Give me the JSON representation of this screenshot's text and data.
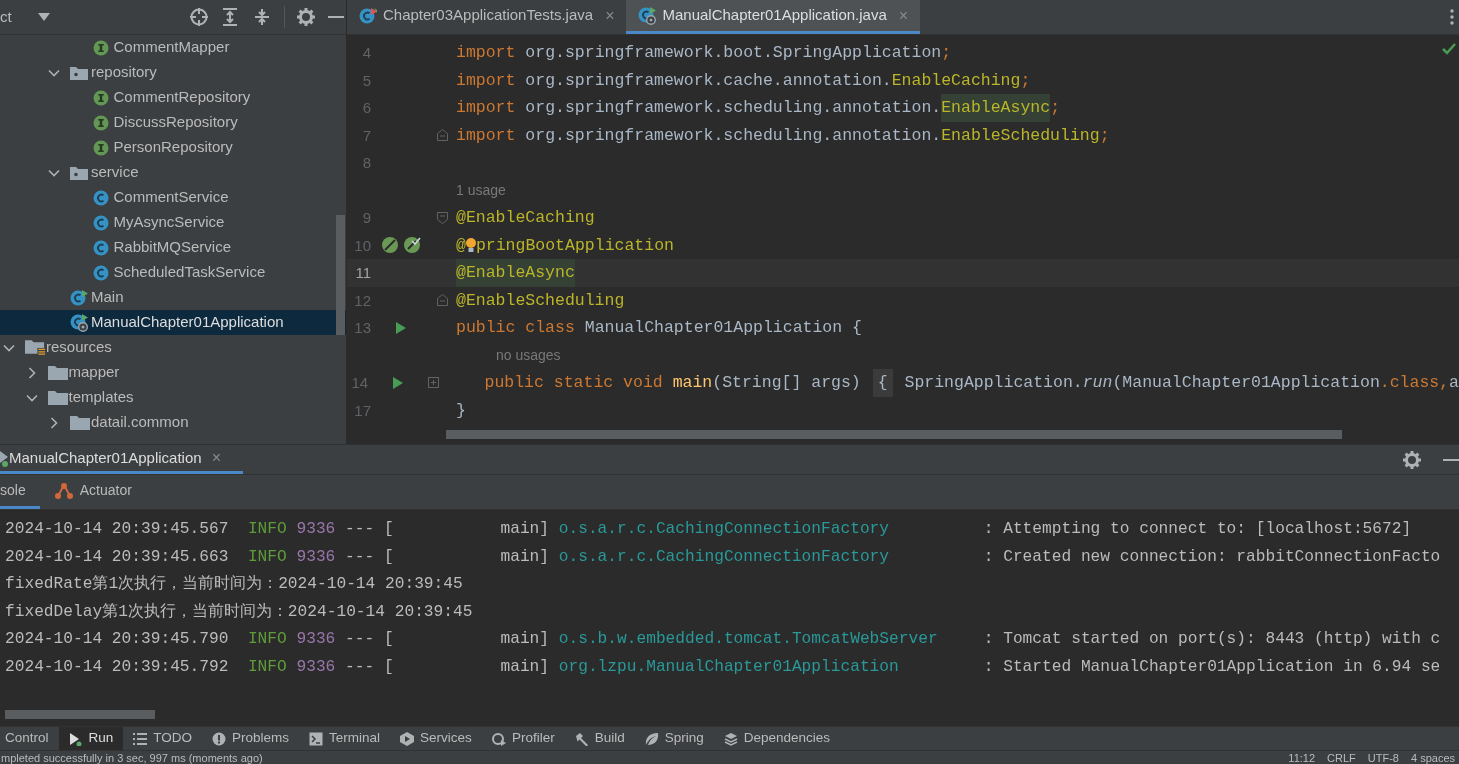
{
  "project_panel": {
    "title": "ct",
    "tree": [
      {
        "children": [
          {
            "children": [
              {
                "children": [
                  {
                    "label": "CommentMapper",
                    "kind": "interface",
                    "selected": false
                  }
                ]
              },
              {
                "label": "repository",
                "kind": "package",
                "expanded": true,
                "selected": false,
                "children": [
                  {
                    "label": "CommentRepository",
                    "kind": "interface",
                    "selected": false
                  },
                  {
                    "label": "DiscussRepository",
                    "kind": "interface",
                    "selected": false
                  },
                  {
                    "label": "PersonRepository",
                    "kind": "interface",
                    "selected": false
                  }
                ]
              },
              {
                "label": "service",
                "kind": "package",
                "expanded": true,
                "selected": false,
                "children": [
                  {
                    "label": "CommentService",
                    "kind": "class",
                    "selected": false
                  },
                  {
                    "label": "MyAsyncService",
                    "kind": "class",
                    "selected": false
                  },
                  {
                    "label": "RabbitMQService",
                    "kind": "class",
                    "selected": false
                  },
                  {
                    "label": "ScheduledTaskService",
                    "kind": "class",
                    "selected": false
                  }
                ]
              },
              {
                "label": "Main",
                "kind": "main-class",
                "selected": false
              },
              {
                "label": "ManualChapter01Application",
                "kind": "spring-app",
                "selected": true
              }
            ]
          }
        ]
      },
      {
        "label": "resources",
        "kind": "resources",
        "expanded": true,
        "selected": false,
        "children": [
          {
            "label": "mapper",
            "kind": "folder",
            "expanded": false,
            "selected": false
          },
          {
            "label": "templates",
            "kind": "folder",
            "expanded": true,
            "selected": false,
            "children": [
              {
                "label": "datail.common",
                "kind": "folder",
                "expanded": false,
                "selected": false
              }
            ]
          }
        ]
      }
    ]
  },
  "editor_tabs": [
    {
      "label": "Chapter03ApplicationTests.java",
      "close": "×",
      "kind": "test-class",
      "selected": false
    },
    {
      "label": "ManualChapter01Application.java",
      "close": "×",
      "kind": "spring-app",
      "selected": true
    }
  ],
  "code_lines": [
    {
      "number": "4",
      "current": false,
      "tokens": [
        {
          "kind": "kw",
          "text": "import"
        },
        {
          "kind": "plain",
          "text": " org.springframework.boot.SpringApplication"
        },
        {
          "kind": "kw",
          "text": ";"
        }
      ]
    },
    {
      "number": "5",
      "current": false,
      "tokens": [
        {
          "kind": "kw",
          "text": "import"
        },
        {
          "kind": "plain",
          "text": " org.springframework.cache.annotation."
        },
        {
          "kind": "ann",
          "text": "EnableCaching"
        },
        {
          "kind": "kw",
          "text": ";"
        }
      ]
    },
    {
      "number": "6",
      "current": false,
      "tokens": [
        {
          "kind": "kw",
          "text": "import"
        },
        {
          "kind": "plain",
          "text": " org.springframework.scheduling.annotation."
        },
        {
          "kind": "ann-hl",
          "text": "EnableAsync"
        },
        {
          "kind": "kw",
          "text": ";"
        }
      ]
    },
    {
      "number": "7",
      "current": false,
      "fold_end": true,
      "tokens": [
        {
          "kind": "kw",
          "text": "import"
        },
        {
          "kind": "plain",
          "text": " org.springframework.scheduling.annotation."
        },
        {
          "kind": "ann",
          "text": "EnableScheduling"
        },
        {
          "kind": "kw",
          "text": ";"
        }
      ]
    },
    {
      "number": "8",
      "current": false
    },
    {
      "hint": "1 usage"
    },
    {
      "number": "9",
      "current": false,
      "fold_start": true,
      "tokens": [
        {
          "kind": "ann",
          "text": "@EnableCaching"
        }
      ]
    },
    {
      "number": "10",
      "current": false,
      "bean_markers": true,
      "tokens": [
        {
          "kind": "ann",
          "text": "@"
        },
        {
          "kind": "bulb"
        },
        {
          "kind": "ann",
          "text": "pringBootApplication"
        }
      ]
    },
    {
      "number": "11",
      "current": true,
      "tokens": [
        {
          "kind": "ann-hl",
          "text": "@EnableAsync"
        }
      ]
    },
    {
      "number": "12",
      "current": false,
      "fold_end": true,
      "tokens": [
        {
          "kind": "ann",
          "text": "@EnableScheduling"
        }
      ]
    },
    {
      "number": "13",
      "current": false,
      "runnable": true,
      "tokens": [
        {
          "kind": "kw",
          "text": "public class "
        },
        {
          "kind": "plain",
          "text": "ManualChapter01Application {"
        }
      ]
    },
    {
      "hint": "no usages",
      "indented": true
    },
    {
      "number": "14",
      "current": false,
      "runnable": true,
      "folded": true,
      "indented": true,
      "tokens": [
        {
          "kind": "kw",
          "text": "public static void "
        },
        {
          "kind": "method",
          "text": "main"
        },
        {
          "kind": "plain",
          "text": "(String[] args) "
        },
        {
          "kind": "folded",
          "text": "{"
        },
        {
          "kind": "plain",
          "text": " SpringApplication."
        },
        {
          "kind": "call",
          "text": "run"
        },
        {
          "kind": "plain",
          "text": "(ManualChapter01Application"
        },
        {
          "kind": "kw",
          "text": ".class,"
        },
        {
          "kind": "plain",
          "text": "a"
        }
      ]
    },
    {
      "number": "17",
      "current": false,
      "tokens": [
        {
          "kind": "plain",
          "text": "}"
        }
      ]
    }
  ],
  "run_panel": {
    "tab": {
      "label": "ManualChapter01Application",
      "close": "×"
    },
    "subtabs": [
      {
        "label": "sole",
        "kind": "console",
        "selected": true
      },
      {
        "label": "Actuator",
        "kind": "actuator",
        "selected": false
      }
    ],
    "console": [
      {
        "kind": "log",
        "timestamp": "2024-10-14 20:39:45.567",
        "level": "INFO",
        "pid": "9336",
        "separator": "---",
        "thread": "[           main]",
        "logger": "o.s.a.r.c.CachingConnectionFactory",
        "message": ": Attempting to connect to: [localhost:5672]"
      },
      {
        "kind": "log",
        "timestamp": "2024-10-14 20:39:45.663",
        "level": "INFO",
        "pid": "9336",
        "separator": "---",
        "thread": "[           main]",
        "logger": "o.s.a.r.c.CachingConnectionFactory",
        "message": ": Created new connection: rabbitConnectionFacto"
      },
      {
        "kind": "text",
        "text": "fixedRate第1次执行，当前时间为：2024-10-14 20:39:45"
      },
      {
        "kind": "text",
        "text": "fixedDelay第1次执行，当前时间为：2024-10-14 20:39:45"
      },
      {
        "kind": "log",
        "timestamp": "2024-10-14 20:39:45.790",
        "level": "INFO",
        "pid": "9336",
        "separator": "---",
        "thread": "[           main]",
        "logger": "o.s.b.w.embedded.tomcat.TomcatWebServer",
        "message": ": Tomcat started on port(s): 8443 (http) with c"
      },
      {
        "kind": "log",
        "timestamp": "2024-10-14 20:39:45.792",
        "level": "INFO",
        "pid": "9336",
        "separator": "---",
        "thread": "[           main]",
        "logger": "org.lzpu.ManualChapter01Application",
        "message": ": Started ManualChapter01Application in 6.94 se"
      }
    ]
  },
  "tool_windows": [
    {
      "label": "Control",
      "kind": "none",
      "selected": false
    },
    {
      "label": "Run",
      "kind": "run",
      "selected": true
    },
    {
      "label": "TODO",
      "kind": "list",
      "selected": false
    },
    {
      "label": "Problems",
      "kind": "problems",
      "selected": false
    },
    {
      "label": "Terminal",
      "kind": "terminal",
      "selected": false
    },
    {
      "label": "Services",
      "kind": "services",
      "selected": false
    },
    {
      "label": "Profiler",
      "kind": "profiler",
      "selected": false
    },
    {
      "label": "Build",
      "kind": "build",
      "selected": false
    },
    {
      "label": "Spring",
      "kind": "spring",
      "selected": false
    },
    {
      "label": "Dependencies",
      "kind": "layers",
      "selected": false
    }
  ],
  "status_bar": {
    "message": "mpleted successfully in 3 sec, 997 ms (moments ago)",
    "items": [
      "11:12",
      "CRLF",
      "UTF-8",
      "4 spaces"
    ]
  }
}
